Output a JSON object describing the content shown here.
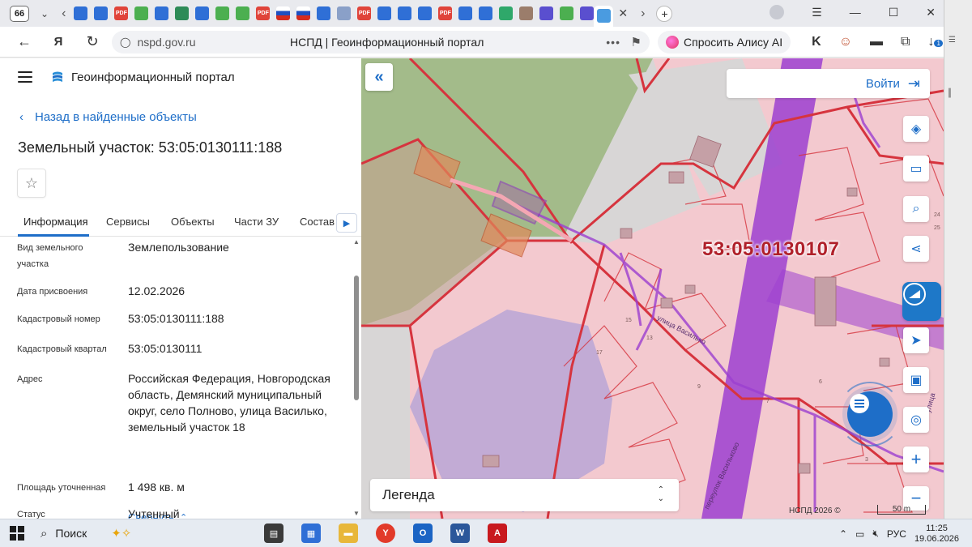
{
  "browser": {
    "tab_count": "66",
    "url_host": "nspd.gov.ru",
    "page_title": "НСПД | Геоинформационный портал",
    "alice_label": "Спросить Алису AI",
    "downloads_badge": "1"
  },
  "left_panel": {
    "portal_title": "Геоинформационный портал",
    "back_label": "Назад в найденные объекты",
    "parcel_title": "Земельный участок: 53:05:0130111:188",
    "tabs": [
      {
        "label": "Информация"
      },
      {
        "label": "Сервисы"
      },
      {
        "label": "Объекты"
      },
      {
        "label": "Части ЗУ"
      },
      {
        "label": "Состав"
      }
    ],
    "properties": [
      {
        "label": "Вид земельного участка",
        "value": "Землепользование"
      },
      {
        "label": "Дата присвоения",
        "value": "12.02.2026"
      },
      {
        "label": "Кадастровый номер",
        "value": "53:05:0130111:188"
      },
      {
        "label": "Кадастровый квартал",
        "value": "53:05:0130111"
      },
      {
        "label": "Адрес",
        "value": "Российская Федерация, Новгородская область, Демянский муниципальный округ, село Полново, улица Василько, земельный участок 18"
      },
      {
        "label": "Площадь уточненная",
        "value": "1 498 кв. м"
      },
      {
        "label": "Статус",
        "value": "Учтенный"
      }
    ],
    "collapse_label": "Свернуть"
  },
  "map": {
    "login_label": "Войти",
    "cadastral_label": "53:05:0130107",
    "street_1": "улица Василько",
    "street_2": "улица",
    "lane": "переулок Васильково",
    "house_numbers": [
      "15",
      "17",
      "13",
      "9",
      "7",
      "6",
      "3",
      "24",
      "25"
    ],
    "legend_label": "Легенда",
    "copyright": "НСПД 2026 ©",
    "scale": "50 m",
    "colors": {
      "parcel_fill": "#f3c9cf",
      "boundary": "#d6343e",
      "road": "#9c3fd0",
      "forest": "#a3bb8a",
      "water": "#b9a6d6",
      "accent": "#1e6ec8"
    }
  },
  "taskbar": {
    "search_label": "Поиск",
    "lang": "РУС",
    "time": "11:25",
    "date": "19.06.2026"
  }
}
